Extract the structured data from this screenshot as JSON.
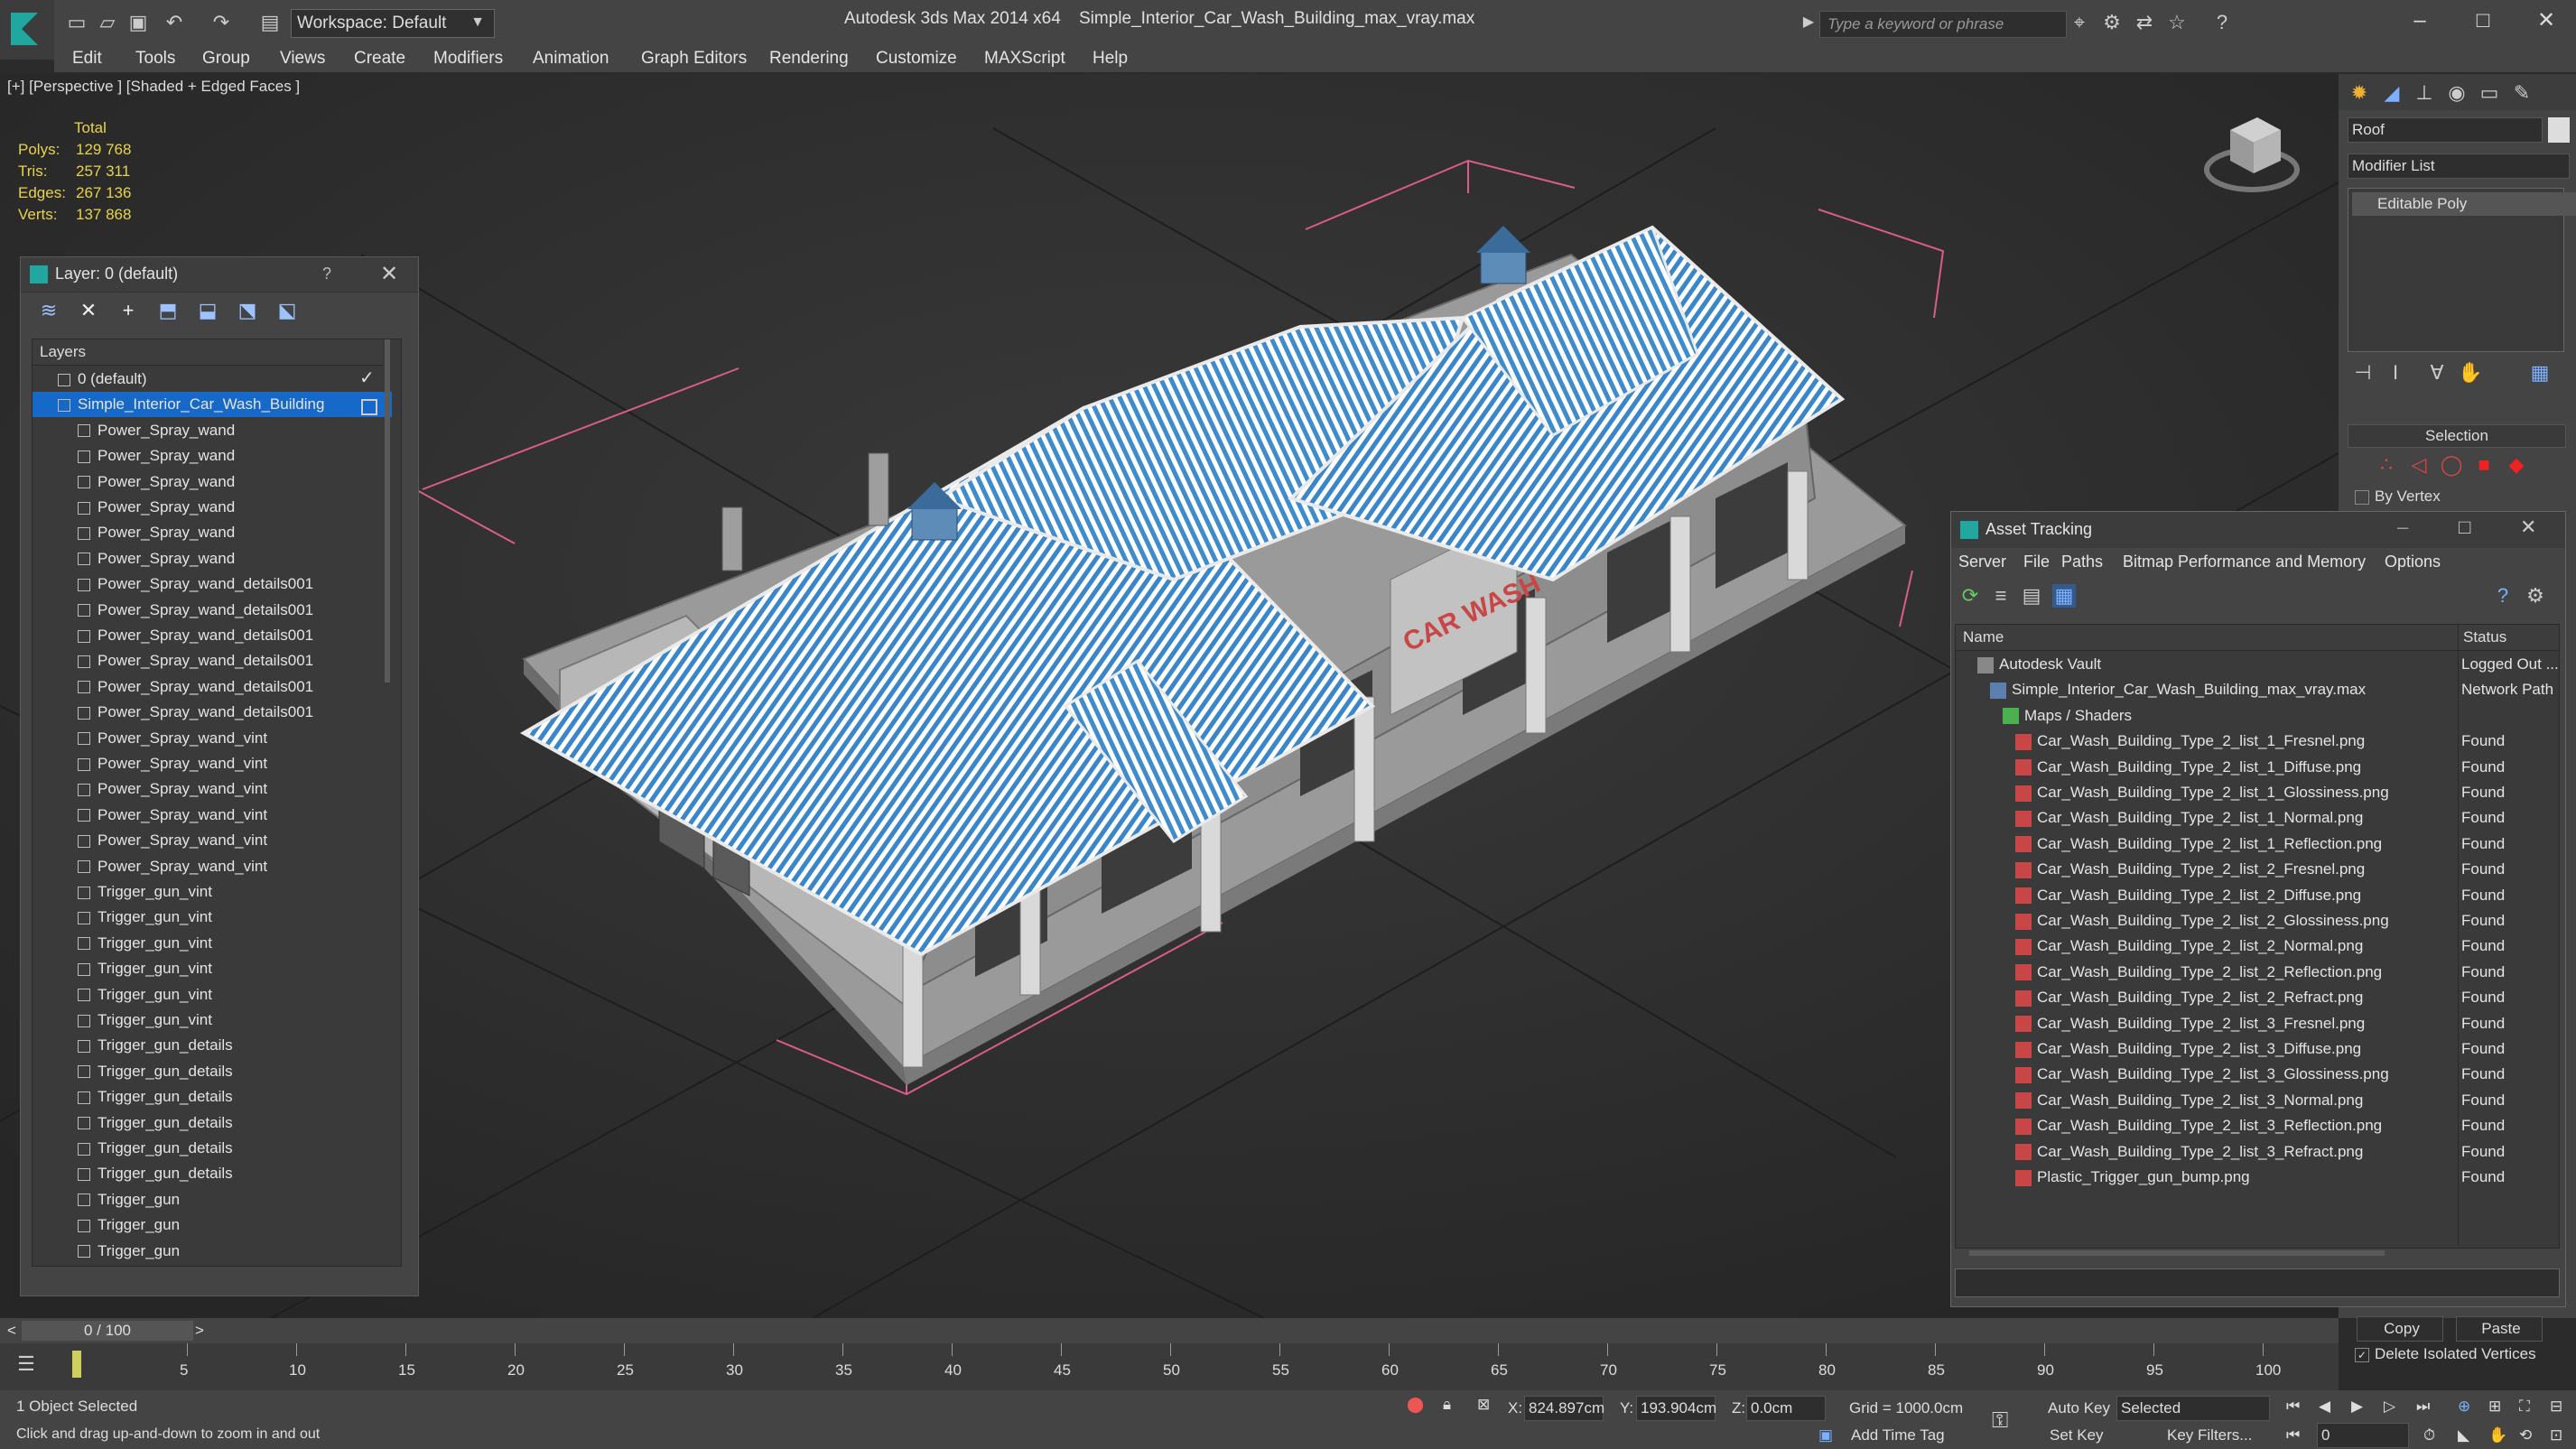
{
  "titlebar": {
    "workspace": "Workspace: Default",
    "app": "Autodesk 3ds Max  2014 x64",
    "file": "Simple_Interior_Car_Wash_Building_max_vray.max",
    "search_placeholder": "Type a keyword or phrase"
  },
  "menu": [
    "Edit",
    "Tools",
    "Group",
    "Views",
    "Create",
    "Modifiers",
    "Animation",
    "Graph Editors",
    "Rendering",
    "Customize",
    "MAXScript",
    "Help"
  ],
  "viewport": {
    "label": "[+] [Perspective ] [Shaded + Edged Faces ]",
    "stats_header": "Total",
    "stats": [
      {
        "label": "Polys:",
        "value": "129 768"
      },
      {
        "label": "Tris:",
        "value": "257 311"
      },
      {
        "label": "Edges:",
        "value": "267 136"
      },
      {
        "label": "Verts:",
        "value": "137 868"
      }
    ],
    "sign_text": "CAR WASH"
  },
  "layer_panel": {
    "title": "Layer: 0 (default)",
    "help": "?",
    "column": "Layers",
    "rows": [
      "0 (default)",
      "Simple_Interior_Car_Wash_Building",
      "Power_Spray_wand",
      "Power_Spray_wand",
      "Power_Spray_wand",
      "Power_Spray_wand",
      "Power_Spray_wand",
      "Power_Spray_wand",
      "Power_Spray_wand_details001",
      "Power_Spray_wand_details001",
      "Power_Spray_wand_details001",
      "Power_Spray_wand_details001",
      "Power_Spray_wand_details001",
      "Power_Spray_wand_details001",
      "Power_Spray_wand_vint",
      "Power_Spray_wand_vint",
      "Power_Spray_wand_vint",
      "Power_Spray_wand_vint",
      "Power_Spray_wand_vint",
      "Power_Spray_wand_vint",
      "Trigger_gun_vint",
      "Trigger_gun_vint",
      "Trigger_gun_vint",
      "Trigger_gun_vint",
      "Trigger_gun_vint",
      "Trigger_gun_vint",
      "Trigger_gun_details",
      "Trigger_gun_details",
      "Trigger_gun_details",
      "Trigger_gun_details",
      "Trigger_gun_details",
      "Trigger_gun_details",
      "Trigger_gun",
      "Trigger_gun",
      "Trigger_gun"
    ]
  },
  "cmdpanel": {
    "object_name": "Roof",
    "modifier_list": "Modifier List",
    "stack_item": "Editable Poly",
    "selection_title": "Selection",
    "by_vertex": "By Vertex",
    "copy": "Copy",
    "paste": "Paste",
    "delete_isolated": "Delete Isolated Vertices"
  },
  "asset_tracking": {
    "title": "Asset Tracking",
    "menu": [
      "Server",
      "File",
      "Paths",
      "Bitmap Performance and Memory",
      "Options"
    ],
    "col_name": "Name",
    "col_status": "Status",
    "rows": [
      {
        "name": "Autodesk Vault",
        "status": "Logged Out ...",
        "indent": 1,
        "icon": "vault"
      },
      {
        "name": "Simple_Interior_Car_Wash_Building_max_vray.max",
        "status": "Network Path",
        "indent": 2,
        "icon": "max"
      },
      {
        "name": "Maps / Shaders",
        "status": "",
        "indent": 3,
        "icon": "folder"
      },
      {
        "name": "Car_Wash_Building_Type_2_list_1_Fresnel.png",
        "status": "Found",
        "indent": 4,
        "icon": "png"
      },
      {
        "name": "Car_Wash_Building_Type_2_list_1_Diffuse.png",
        "status": "Found",
        "indent": 4,
        "icon": "png"
      },
      {
        "name": "Car_Wash_Building_Type_2_list_1_Glossiness.png",
        "status": "Found",
        "indent": 4,
        "icon": "png"
      },
      {
        "name": "Car_Wash_Building_Type_2_list_1_Normal.png",
        "status": "Found",
        "indent": 4,
        "icon": "png"
      },
      {
        "name": "Car_Wash_Building_Type_2_list_1_Reflection.png",
        "status": "Found",
        "indent": 4,
        "icon": "png"
      },
      {
        "name": "Car_Wash_Building_Type_2_list_2_Fresnel.png",
        "status": "Found",
        "indent": 4,
        "icon": "png"
      },
      {
        "name": "Car_Wash_Building_Type_2_list_2_Diffuse.png",
        "status": "Found",
        "indent": 4,
        "icon": "png"
      },
      {
        "name": "Car_Wash_Building_Type_2_list_2_Glossiness.png",
        "status": "Found",
        "indent": 4,
        "icon": "png"
      },
      {
        "name": "Car_Wash_Building_Type_2_list_2_Normal.png",
        "status": "Found",
        "indent": 4,
        "icon": "png"
      },
      {
        "name": "Car_Wash_Building_Type_2_list_2_Reflection.png",
        "status": "Found",
        "indent": 4,
        "icon": "png"
      },
      {
        "name": "Car_Wash_Building_Type_2_list_2_Refract.png",
        "status": "Found",
        "indent": 4,
        "icon": "png"
      },
      {
        "name": "Car_Wash_Building_Type_2_list_3_Fresnel.png",
        "status": "Found",
        "indent": 4,
        "icon": "png"
      },
      {
        "name": "Car_Wash_Building_Type_2_list_3_Diffuse.png",
        "status": "Found",
        "indent": 4,
        "icon": "png"
      },
      {
        "name": "Car_Wash_Building_Type_2_list_3_Glossiness.png",
        "status": "Found",
        "indent": 4,
        "icon": "png"
      },
      {
        "name": "Car_Wash_Building_Type_2_list_3_Normal.png",
        "status": "Found",
        "indent": 4,
        "icon": "png"
      },
      {
        "name": "Car_Wash_Building_Type_2_list_3_Reflection.png",
        "status": "Found",
        "indent": 4,
        "icon": "png"
      },
      {
        "name": "Car_Wash_Building_Type_2_list_3_Refract.png",
        "status": "Found",
        "indent": 4,
        "icon": "png"
      },
      {
        "name": "Plastic_Trigger_gun_bump.png",
        "status": "Found",
        "indent": 4,
        "icon": "png"
      }
    ]
  },
  "timeline": {
    "frame": "0 / 100",
    "ticks": [
      "5",
      "10",
      "15",
      "20",
      "25",
      "30",
      "35",
      "40",
      "45",
      "50",
      "55",
      "60",
      "65",
      "70",
      "75",
      "80",
      "85",
      "90",
      "95",
      "100"
    ]
  },
  "status": {
    "selected": "1 Object Selected",
    "hint": "Click and drag up-and-down to zoom in and out",
    "x_label": "X:",
    "x": "824.897cm",
    "y_label": "Y:",
    "y": "193.904cm",
    "z_label": "Z:",
    "z": "0.0cm",
    "grid": "Grid = 1000.0cm",
    "add_time_tag": "Add Time Tag",
    "auto_key": "Auto Key",
    "set_key": "Set Key",
    "key_mode": "Selected",
    "key_filters": "Key Filters...",
    "frame_field": "0"
  },
  "colors": {
    "accent": "#1769c9",
    "roof_blue": "#3a86c8",
    "stats_yellow": "#e8d24a",
    "bbox_pink": "#d85c8c"
  }
}
